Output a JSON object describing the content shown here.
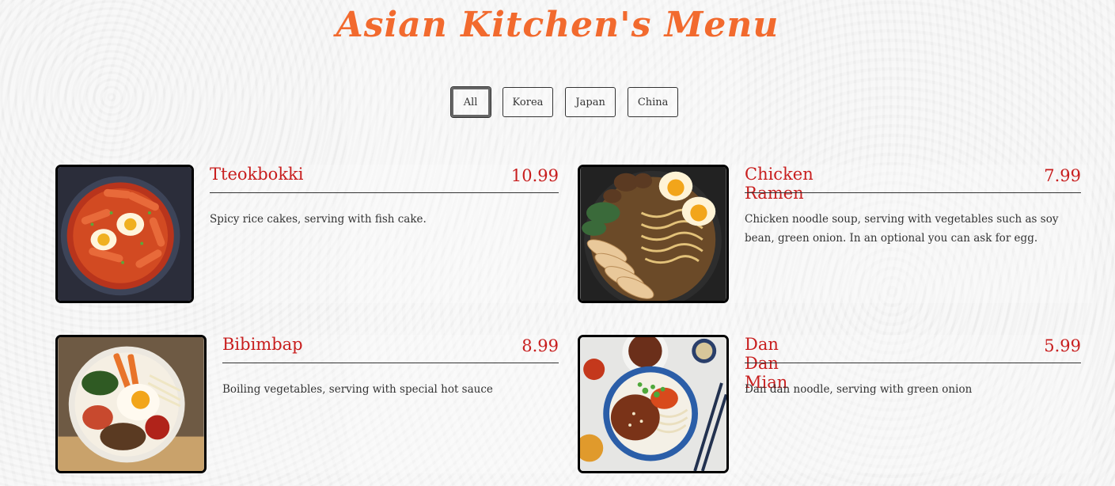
{
  "header": {
    "title": "Asian Kitchen's Menu"
  },
  "filters": [
    {
      "label": "All",
      "active": true
    },
    {
      "label": "Korea",
      "active": false
    },
    {
      "label": "Japan",
      "active": false
    },
    {
      "label": "China",
      "active": false
    }
  ],
  "menu": [
    {
      "name": "Tteokbokki",
      "price": "10.99",
      "desc": "Spicy rice cakes, serving with fish cake."
    },
    {
      "name": "Chicken Ramen",
      "price": "7.99",
      "desc": "Chicken noodle soup, serving with vegetables such as soy bean, green onion. In an optional you can ask for egg."
    },
    {
      "name": "Bibimbap",
      "price": "8.99",
      "desc": "Boiling vegetables, serving with special hot sauce"
    },
    {
      "name": "Dan Dan Mian",
      "price": "5.99",
      "desc": "Dan dan noodle, serving with green onion"
    }
  ],
  "colors": {
    "accent": "#f26a2e",
    "item_title": "#c81e1e"
  }
}
